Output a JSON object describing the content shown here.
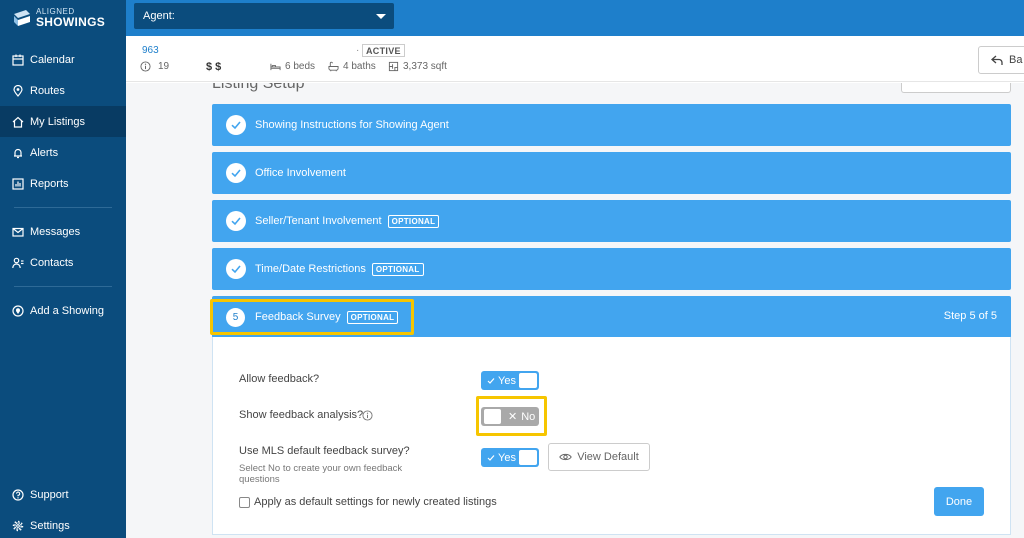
{
  "brand": {
    "line1": "ALIGNED",
    "line2": "SHOWINGS"
  },
  "topbar": {
    "agent_label": "Agent:"
  },
  "sidebar": {
    "items": [
      {
        "label": "Calendar",
        "icon": "calendar-icon"
      },
      {
        "label": "Routes",
        "icon": "location-pin-icon"
      },
      {
        "label": "My Listings",
        "icon": "home-icon",
        "active": true
      },
      {
        "label": "Alerts",
        "icon": "bell-icon"
      },
      {
        "label": "Reports",
        "icon": "bar-chart-icon"
      },
      {
        "label": "Messages",
        "icon": "mail-icon"
      },
      {
        "label": "Contacts",
        "icon": "contacts-icon"
      },
      {
        "label": "Add a Showing",
        "icon": "add-location-icon"
      }
    ],
    "bottom": [
      {
        "label": "Support",
        "icon": "help-icon"
      },
      {
        "label": "Settings",
        "icon": "gear-icon"
      }
    ]
  },
  "listing": {
    "number": "963",
    "dot": "·",
    "status": "ACTIVE",
    "count": "19",
    "price": "$ $",
    "beds": "6 beds",
    "baths": "4 baths",
    "sqft": "3,373 sqft",
    "back_label": "Ba"
  },
  "main": {
    "title": "Listing Setup",
    "steps": [
      {
        "label": "Showing Instructions for Showing Agent",
        "optional": ""
      },
      {
        "label": "Office Involvement",
        "optional": ""
      },
      {
        "label": "Seller/Tenant Involvement",
        "optional": "OPTIONAL"
      },
      {
        "label": "Time/Date Restrictions",
        "optional": "OPTIONAL"
      }
    ],
    "current_step": {
      "number": "5",
      "label": "Feedback Survey",
      "optional": "OPTIONAL",
      "progress": "Step 5 of 5"
    }
  },
  "feedback": {
    "allow_label": "Allow feedback?",
    "allow_value": "Yes",
    "analysis_label": "Show feedback analysis?",
    "analysis_value": "No",
    "mls_label": "Use MLS default feedback survey?",
    "mls_sub": "Select No to create your own feedback questions",
    "mls_value": "Yes",
    "view_default_label": "View Default",
    "apply_label": "Apply as default settings for newly created listings",
    "done_label": "Done"
  },
  "colors": {
    "sidebar": "#0b4c7d",
    "topbar": "#1e7fcb",
    "step": "#42a5ef",
    "highlight": "#f6c500"
  }
}
